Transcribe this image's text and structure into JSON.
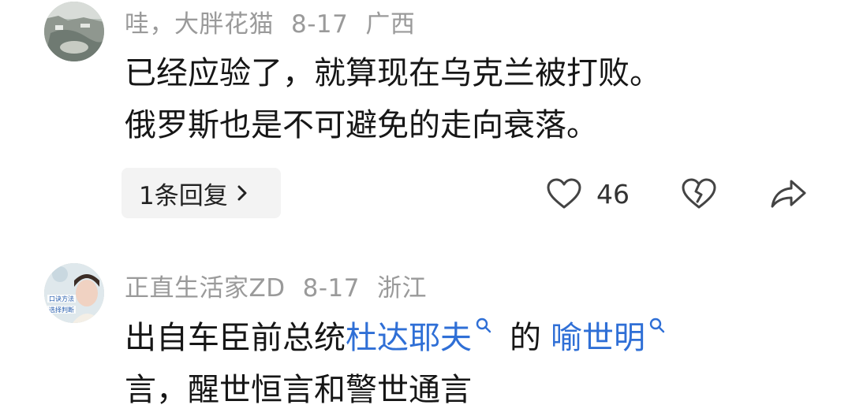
{
  "comments": [
    {
      "username": "哇，大胖花猫",
      "date": "8-17",
      "location": "广西",
      "lines": [
        "已经应验了，就算现在乌克兰被打败。",
        "俄罗斯也是不可避免的走向衰落。"
      ],
      "reply_label": "1条回复",
      "like_count": "46"
    },
    {
      "username": "正直生活家ZD",
      "date": "8-17",
      "location": "浙江",
      "line1_before": "出自车臣前总统",
      "line1_link1": "杜达耶夫",
      "line1_middle": "的",
      "line1_link2": "喻世明",
      "line2": "言，醒世恒言和警世通言",
      "avatar_text": [
        "口诀方法",
        "选择判断"
      ]
    }
  ],
  "icons": {
    "heart": "heart-icon",
    "broken_heart": "broken-heart-icon",
    "share": "share-icon",
    "chevron": "chevron-right-icon",
    "search": "search-icon"
  },
  "colors": {
    "link": "#2f6fd6",
    "meta": "#9a9a9a"
  }
}
